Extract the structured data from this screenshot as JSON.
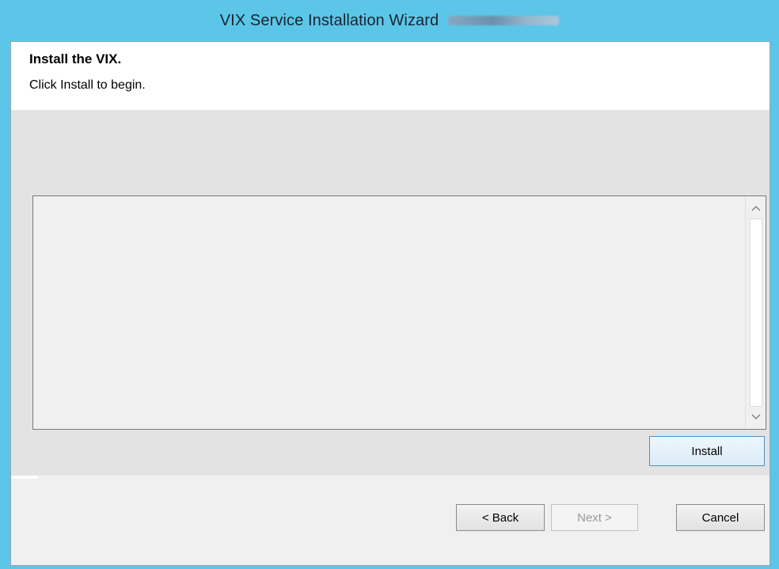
{
  "window": {
    "title": "VIX Service Installation Wizard"
  },
  "header": {
    "title": "Install the VIX.",
    "subtitle": "Click Install to begin."
  },
  "log": {
    "scroll_up_icon": "chevron-up-icon",
    "scroll_down_icon": "chevron-down-icon"
  },
  "buttons": {
    "install": "Install",
    "back": "< Back",
    "next": "Next >",
    "cancel": "Cancel"
  },
  "colors": {
    "titlebar": "#5bc6e8",
    "header_bg": "#ffffff",
    "body_bg": "#e3e3e3",
    "install_border": "#4a90c8",
    "disabled_text": "#9a9a9a"
  }
}
